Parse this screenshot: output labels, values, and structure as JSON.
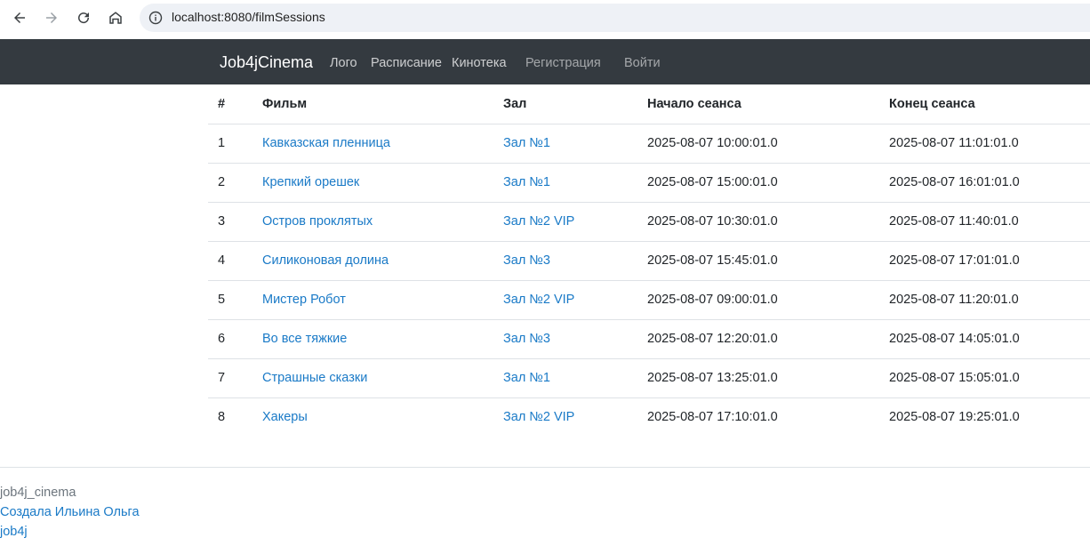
{
  "browser": {
    "url": "localhost:8080/filmSessions",
    "icons": [
      "back-arrow-icon",
      "forward-arrow-icon",
      "reload-icon",
      "home-icon",
      "info-icon"
    ]
  },
  "navbar": {
    "brand": "Job4jCinema",
    "links": [
      {
        "label": "Лого"
      },
      {
        "label": "Расписание"
      },
      {
        "label": "Кинотека"
      },
      {
        "label": "Регистрация"
      },
      {
        "label": "Войти"
      }
    ]
  },
  "table": {
    "headers": [
      "#",
      "Фильм",
      "Зал",
      "Начало сеанса",
      "Конец сеанса"
    ],
    "rows": [
      {
        "num": "1",
        "film": "Кавказская пленница",
        "hall": "Зал №1",
        "start": "2025-08-07 10:00:01.0",
        "end": "2025-08-07 11:01:01.0"
      },
      {
        "num": "2",
        "film": "Крепкий орешек",
        "hall": "Зал №1",
        "start": "2025-08-07 15:00:01.0",
        "end": "2025-08-07 16:01:01.0"
      },
      {
        "num": "3",
        "film": "Остров проклятых",
        "hall": "Зал №2 VIP",
        "start": "2025-08-07 10:30:01.0",
        "end": "2025-08-07 11:40:01.0"
      },
      {
        "num": "4",
        "film": "Силиконовая долина",
        "hall": "Зал №3",
        "start": "2025-08-07 15:45:01.0",
        "end": "2025-08-07 17:01:01.0"
      },
      {
        "num": "5",
        "film": "Мистер Робот",
        "hall": "Зал №2 VIP",
        "start": "2025-08-07 09:00:01.0",
        "end": "2025-08-07 11:20:01.0"
      },
      {
        "num": "6",
        "film": "Во все тяжкие",
        "hall": "Зал №3",
        "start": "2025-08-07 12:20:01.0",
        "end": "2025-08-07 14:05:01.0"
      },
      {
        "num": "7",
        "film": "Страшные сказки",
        "hall": "Зал №1",
        "start": "2025-08-07 13:25:01.0",
        "end": "2025-08-07 15:05:01.0"
      },
      {
        "num": "8",
        "film": "Хакеры",
        "hall": "Зал №2 VIP",
        "start": "2025-08-07 17:10:01.0",
        "end": "2025-08-07 19:25:01.0"
      }
    ]
  },
  "footer": {
    "project": "job4j_cinema",
    "author_link": "Создала Ильина Ольга",
    "job4j_link": "job4j"
  },
  "colors": {
    "navbar_bg": "#343a40",
    "link": "#1a7ac7"
  }
}
